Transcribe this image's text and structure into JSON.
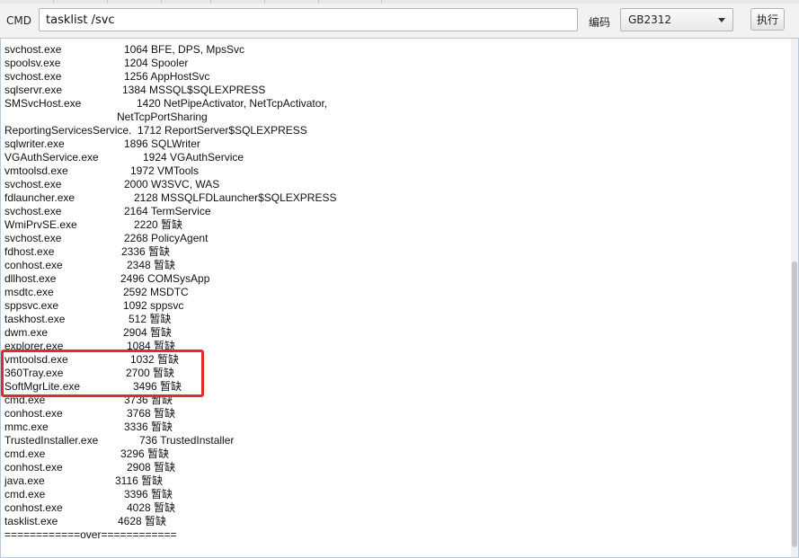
{
  "toolbar": {
    "cmd_label": "CMD",
    "cmd_value": "tasklist /svc",
    "encoding_label": "编码",
    "encoding_value": "GB2312",
    "run_label": "执行"
  },
  "output": {
    "lines": [
      {
        "name": "svchost.exe",
        "info": "1064 BFE, DPS, MpsSvc"
      },
      {
        "name": "spoolsv.exe",
        "info": "1204 Spooler"
      },
      {
        "name": "svchost.exe",
        "info": "1256 AppHostSvc"
      },
      {
        "name": "sqlservr.exe",
        "info": "1384 MSSQL$SQLEXPRESS"
      },
      {
        "name": "SMSvcHost.exe",
        "info": "1420 NetPipeActivator, NetTcpActivator,"
      },
      {
        "name": "",
        "info": "NetTcpPortSharing"
      },
      {
        "name": "ReportingServicesService.",
        "info": "1712 ReportServer$SQLEXPRESS"
      },
      {
        "name": "sqlwriter.exe",
        "info": "1896 SQLWriter"
      },
      {
        "name": "VGAuthService.exe",
        "info": "1924 VGAuthService"
      },
      {
        "name": "vmtoolsd.exe",
        "info": "1972 VMTools"
      },
      {
        "name": "svchost.exe",
        "info": "2000 W3SVC, WAS"
      },
      {
        "name": "fdlauncher.exe",
        "info": "2128 MSSQLFDLauncher$SQLEXPRESS"
      },
      {
        "name": "svchost.exe",
        "info": "2164 TermService"
      },
      {
        "name": "WmiPrvSE.exe",
        "info": "2220 暂缺"
      },
      {
        "name": "svchost.exe",
        "info": "2268 PolicyAgent"
      },
      {
        "name": "fdhost.exe",
        "info": "2336 暂缺"
      },
      {
        "name": "conhost.exe",
        "info": "2348 暂缺"
      },
      {
        "name": "dllhost.exe",
        "info": "2496 COMSysApp"
      },
      {
        "name": "msdtc.exe",
        "info": "2592 MSDTC"
      },
      {
        "name": "sppsvc.exe",
        "info": "1092 sppsvc"
      },
      {
        "name": "taskhost.exe",
        "info": "512 暂缺"
      },
      {
        "name": "dwm.exe",
        "info": "2904 暂缺"
      },
      {
        "name": "explorer.exe",
        "info": "1084 暂缺"
      },
      {
        "name": "vmtoolsd.exe",
        "info": "1032 暂缺"
      },
      {
        "name": "360Tray.exe",
        "info": "2700 暂缺"
      },
      {
        "name": "SoftMgrLite.exe",
        "info": "3496 暂缺"
      },
      {
        "name": "cmd.exe",
        "info": "3736 暂缺"
      },
      {
        "name": "conhost.exe",
        "info": "3768 暂缺"
      },
      {
        "name": "mmc.exe",
        "info": "3336 暂缺"
      },
      {
        "name": "TrustedInstaller.exe",
        "info": "736 TrustedInstaller"
      },
      {
        "name": "cmd.exe",
        "info": "3296 暂缺"
      },
      {
        "name": "conhost.exe",
        "info": "2908 暂缺"
      },
      {
        "name": "java.exe",
        "info": "3116 暂缺"
      },
      {
        "name": "cmd.exe",
        "info": "3396 暂缺"
      },
      {
        "name": "conhost.exe",
        "info": "4028 暂缺"
      },
      {
        "name": "tasklist.exe",
        "info": "4628 暂缺"
      },
      {
        "name": "============over============",
        "info": ""
      }
    ]
  },
  "colors": {
    "highlight_border": "#e4292d",
    "output_border": "#b8c8d8"
  }
}
